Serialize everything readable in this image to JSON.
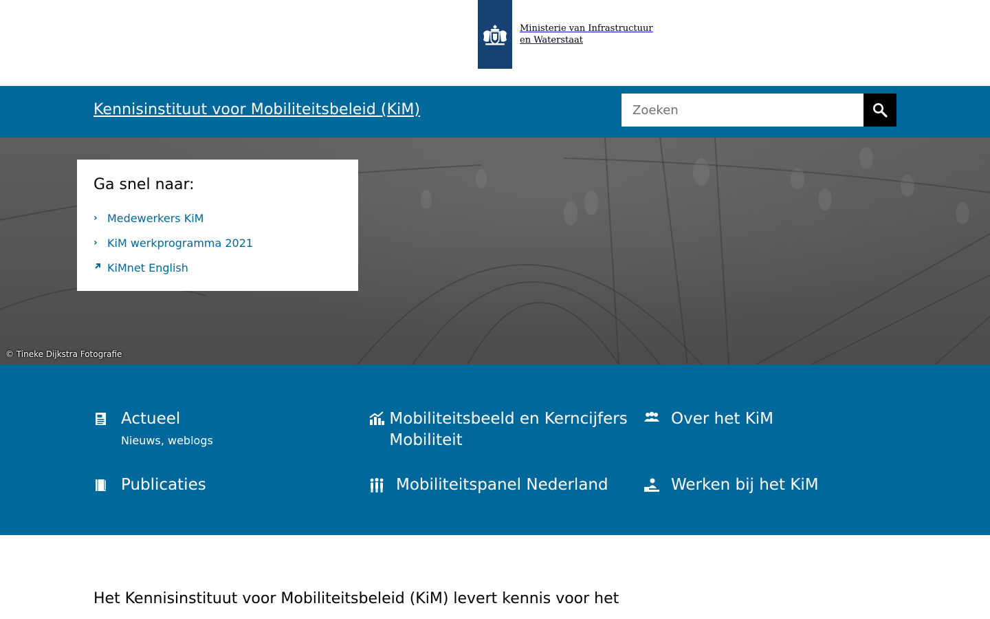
{
  "logo": {
    "line1": "Ministerie van Infrastructuur",
    "line2": "en Waterstaat",
    "icon": "coat-of-arms-icon",
    "ribbon_color": "#154273"
  },
  "header": {
    "site_title": "Kennisinstituut voor Mobiliteitsbeleid (KiM)",
    "search_placeholder": "Zoeken",
    "search_icon": "search-icon",
    "bar_color": "#01689b"
  },
  "quick_links": {
    "title": "Ga snel naar:",
    "items": [
      {
        "label": "Medewerkers KiM",
        "icon": "chevron-right-icon"
      },
      {
        "label": "KiM werkprogramma 2021",
        "icon": "chevron-right-icon"
      },
      {
        "label": "KiMnet English",
        "icon": "external-link-icon"
      }
    ]
  },
  "hero": {
    "credit": "© Tineke Dijkstra Fotografie"
  },
  "tiles": [
    {
      "title": "Actueel",
      "subtitle": "Nieuws, weblogs",
      "icon": "newspaper-icon"
    },
    {
      "title": "Mobiliteitsbeeld en Kerncijfers Mobiliteit",
      "subtitle": "",
      "icon": "chart-icon"
    },
    {
      "title": "Over het KiM",
      "subtitle": "",
      "icon": "people-icon"
    },
    {
      "title": "Publicaties",
      "subtitle": "",
      "icon": "book-icon"
    },
    {
      "title": "Mobiliteitspanel Nederland",
      "subtitle": "",
      "icon": "group-icon"
    },
    {
      "title": "Werken bij het KiM",
      "subtitle": "",
      "icon": "worker-icon"
    }
  ],
  "intro": {
    "text": "Het Kennisinstituut voor Mobiliteitsbeleid (KiM) levert kennis voor het"
  }
}
